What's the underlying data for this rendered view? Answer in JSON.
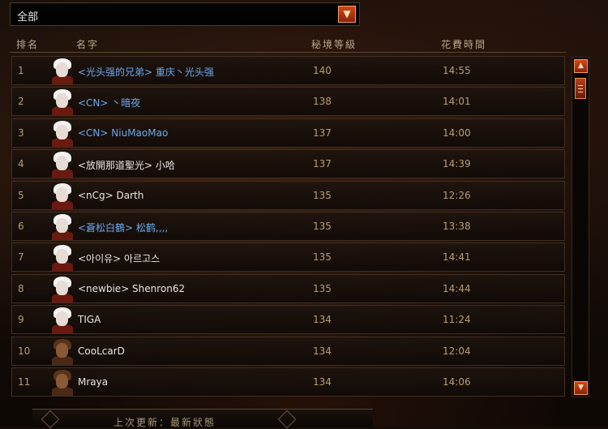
{
  "filter": {
    "selected": "全部",
    "button_icon": "chevron-down-icon",
    "button_glyph": "▼"
  },
  "columns": {
    "rank": "排名",
    "name": "名字",
    "level": "秘境等級",
    "time": "花費時間"
  },
  "rows": [
    {
      "rank": "1",
      "name": "<光头强的兄弟> 重庆丶光头强",
      "level": "140",
      "time": "14:55",
      "name_color": "blue",
      "avatar": "white"
    },
    {
      "rank": "2",
      "name": "<CN> 丶暗夜",
      "level": "138",
      "time": "14:01",
      "name_color": "blue",
      "avatar": "white"
    },
    {
      "rank": "3",
      "name": "<CN> NiuMaoMao",
      "level": "137",
      "time": "14:00",
      "name_color": "blue",
      "avatar": "white"
    },
    {
      "rank": "4",
      "name": "<放開那道聖光> 小哈",
      "level": "137",
      "time": "14:39",
      "name_color": "white",
      "avatar": "white"
    },
    {
      "rank": "5",
      "name": "<nCg> Darth",
      "level": "135",
      "time": "12:26",
      "name_color": "white",
      "avatar": "white"
    },
    {
      "rank": "6",
      "name": "<蒼松白鶴> 松鹤,,,,",
      "level": "135",
      "time": "13:38",
      "name_color": "blue",
      "avatar": "white"
    },
    {
      "rank": "7",
      "name": "<아이유> 아르고스",
      "level": "135",
      "time": "14:41",
      "name_color": "white",
      "avatar": "white"
    },
    {
      "rank": "8",
      "name": "<newbie> Shenron62",
      "level": "135",
      "time": "14:44",
      "name_color": "white",
      "avatar": "white"
    },
    {
      "rank": "9",
      "name": "TIGA",
      "level": "134",
      "time": "11:24",
      "name_color": "white",
      "avatar": "white"
    },
    {
      "rank": "10",
      "name": "CooLcarD",
      "level": "134",
      "time": "12:04",
      "name_color": "white",
      "avatar": "brown"
    },
    {
      "rank": "11",
      "name": "Mraya",
      "level": "134",
      "time": "14:06",
      "name_color": "white",
      "avatar": "brown"
    }
  ],
  "scrollbar": {
    "up_glyph": "▲",
    "down_glyph": "▼"
  },
  "footer": {
    "text": "上次更新：最新狀態"
  },
  "colors": {
    "accent": "#d4461a",
    "name_blue": "#6aa9ee",
    "text_gold": "#b89c72"
  }
}
